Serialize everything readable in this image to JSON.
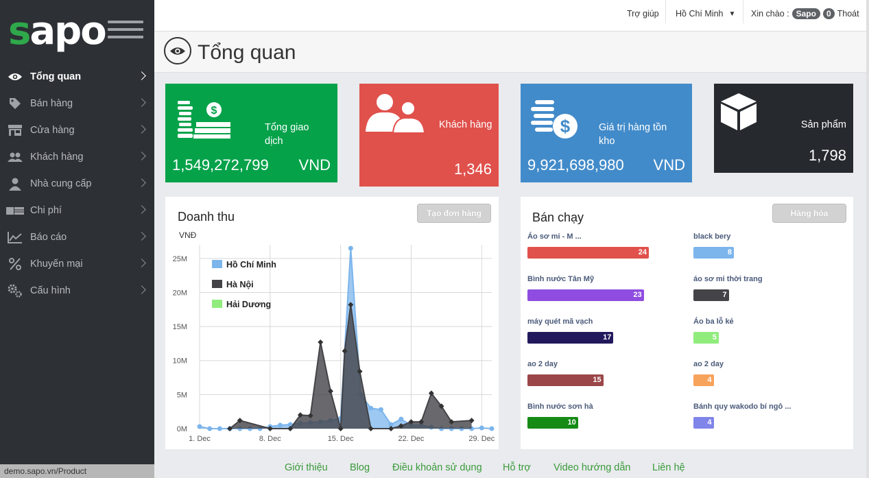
{
  "brand": {
    "logo_first": "s",
    "logo_rest": "apo"
  },
  "topbar": {
    "help": "Trợ giúp",
    "location": "Hồ Chí Minh",
    "greeting": "Xin chào :",
    "user": "Sapo",
    "notifications": "0",
    "logout": "Thoát"
  },
  "sidebar": {
    "items": [
      {
        "label": "Tổng quan",
        "icon": "eye-icon"
      },
      {
        "label": "Bán hàng",
        "icon": "tag-icon"
      },
      {
        "label": "Cửa hàng",
        "icon": "store-icon"
      },
      {
        "label": "Khách hàng",
        "icon": "users-icon"
      },
      {
        "label": "Nhà cung cấp",
        "icon": "supplier-icon"
      },
      {
        "label": "Chi phí",
        "icon": "money-icon"
      },
      {
        "label": "Báo cáo",
        "icon": "chart-line-icon"
      },
      {
        "label": "Khuyến mại",
        "icon": "percent-icon"
      },
      {
        "label": "Cấu hình",
        "icon": "gears-icon"
      }
    ],
    "status_url": "demo.sapo.vn/Product"
  },
  "page": {
    "title": "Tổng quan"
  },
  "stats": {
    "transactions": {
      "label": "Tổng giao dịch",
      "value": "1,549,272,799",
      "unit": "VND",
      "color": "#05a24a"
    },
    "customers": {
      "label": "Khách hàng",
      "value": "1,346",
      "color": "#e0514c"
    },
    "inventory": {
      "label": "Giá trị hàng tồn kho",
      "value": "9,921,698,980",
      "unit": "VND",
      "color": "#428bca"
    },
    "products": {
      "label": "Sản phẩm",
      "value": "1,798",
      "color": "#26292e"
    }
  },
  "revenue": {
    "title": "Doanh thu",
    "button": "Tạo đơn hàng"
  },
  "chart_data": {
    "type": "area",
    "ylabel": "VNĐ",
    "ylim": [
      0,
      27000000
    ],
    "yticks": [
      "0M",
      "5M",
      "10M",
      "15M",
      "20M",
      "25M"
    ],
    "xticks": [
      "1. Dec",
      "8. Dec",
      "15. Dec",
      "22. Dec",
      "29. Dec"
    ],
    "legend_position": "top-left",
    "series": [
      {
        "name": "Hồ Chí Minh",
        "color": "#7cb5ec",
        "points": [
          [
            0,
            0.3
          ],
          [
            1,
            0
          ],
          [
            2,
            0
          ],
          [
            3,
            0
          ],
          [
            4,
            0
          ],
          [
            5,
            0
          ],
          [
            6,
            0
          ],
          [
            7,
            0.3
          ],
          [
            8,
            0.5
          ],
          [
            9,
            0.6
          ],
          [
            10,
            0.8
          ],
          [
            11,
            0.9
          ],
          [
            12,
            1
          ],
          [
            13,
            1.2
          ],
          [
            14,
            1.5
          ],
          [
            15,
            26.5
          ],
          [
            16,
            5
          ],
          [
            17,
            3
          ],
          [
            18,
            2.8
          ],
          [
            19,
            0.6
          ],
          [
            20,
            1.4
          ],
          [
            21,
            0.5
          ],
          [
            22,
            0.5
          ],
          [
            23,
            0.2
          ],
          [
            24,
            0
          ],
          [
            25,
            0
          ],
          [
            26,
            0
          ],
          [
            27,
            0
          ],
          [
            28,
            0.1
          ],
          [
            29,
            0
          ]
        ]
      },
      {
        "name": "Hà Nội",
        "color": "#434348",
        "points": [
          [
            3,
            0
          ],
          [
            4,
            1.2
          ],
          [
            7,
            0
          ],
          [
            9,
            0
          ],
          [
            10,
            2
          ],
          [
            11,
            1.9
          ],
          [
            12,
            12.7
          ],
          [
            13,
            5.5
          ],
          [
            14,
            0
          ],
          [
            14.4,
            11.4
          ],
          [
            15,
            18.2
          ],
          [
            15.9,
            8.4
          ],
          [
            17,
            0
          ],
          [
            19,
            0
          ],
          [
            20,
            0.4
          ],
          [
            21,
            1
          ],
          [
            22,
            1
          ],
          [
            23,
            5.2
          ],
          [
            24,
            3.3
          ],
          [
            25,
            1
          ],
          [
            27,
            1.2
          ]
        ]
      },
      {
        "name": "Hải Dương",
        "color": "#90ed7d",
        "points": []
      }
    ]
  },
  "bestsellers": {
    "title": "Bán chạy",
    "button": "Hàng hóa",
    "items": [
      {
        "name": "Áo sơ mi - M ...",
        "qty": 24,
        "color": "#e0514c"
      },
      {
        "name": "black bery",
        "qty": 8,
        "color": "#7cb5ec"
      },
      {
        "name": "Bình nước Tân Mỹ",
        "qty": 23,
        "color": "#8e4de0"
      },
      {
        "name": "áo sơ mi thời trang",
        "qty": 7,
        "color": "#434348"
      },
      {
        "name": "máy quét mã vạch",
        "qty": 17,
        "color": "#22195c"
      },
      {
        "name": "Áo ba lỗ kẻ",
        "qty": 5,
        "color": "#90ed7d"
      },
      {
        "name": "ao 2 day",
        "qty": 15,
        "color": "#9b4648"
      },
      {
        "name": "ao 2 day",
        "qty": 4,
        "color": "#f7a35c"
      },
      {
        "name": "Bình nước sơn hà",
        "qty": 10,
        "color": "#158a15"
      },
      {
        "name": "Bánh quy wakodo bí ngô ...",
        "qty": 4,
        "color": "#8085e9"
      }
    ]
  },
  "footer": {
    "links": [
      "Giới thiệu",
      "Blog",
      "Điều khoản sử dụng",
      "Hỗ trợ",
      "Video hướng dẫn",
      "Liên hệ"
    ]
  }
}
